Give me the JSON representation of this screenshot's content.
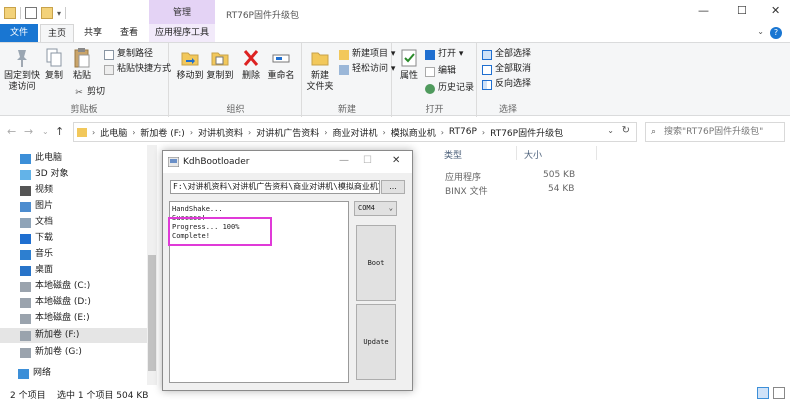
{
  "window": {
    "manage_tab": "管理",
    "title": "RT76P固件升级包",
    "min": "—",
    "max": "☐",
    "close": "✕"
  },
  "tabs": {
    "file": "文件",
    "home": "主页",
    "share": "共享",
    "view": "查看",
    "app_tools": "应用程序工具"
  },
  "ribbon": {
    "clipboard": {
      "label": "剪贴板",
      "pin": "固定到快\n速访问",
      "copy": "复制",
      "paste": "粘贴",
      "copy_path": "复制路径",
      "paste_shortcut": "粘贴快捷方式",
      "cut": "剪切"
    },
    "organize": {
      "label": "组织",
      "move_to": "移动到",
      "copy_to": "复制到",
      "delete": "删除",
      "rename": "重命名"
    },
    "new": {
      "label": "新建",
      "new_folder": "新建\n文件夹",
      "new_item": "新建项目 ▾",
      "easy_access": "轻松访问 ▾"
    },
    "open": {
      "label": "打开",
      "properties": "属性",
      "open": "打开 ▾",
      "edit": "编辑",
      "history": "历史记录"
    },
    "select": {
      "label": "选择",
      "select_all": "全部选择",
      "select_none": "全部取消",
      "invert": "反向选择"
    }
  },
  "address": {
    "crumbs": [
      "此电脑",
      "新加卷 (F:)",
      "对讲机资料",
      "对讲机广告资料",
      "商业对讲机",
      "模拟商业机",
      "RT76P",
      "RT76P固件升级包"
    ],
    "search_placeholder": "搜索\"RT76P固件升级包\""
  },
  "nav": {
    "items": [
      {
        "label": "此电脑",
        "icon": "computer-icon"
      },
      {
        "label": "3D 对象",
        "icon": "3d-objects-icon"
      },
      {
        "label": "视频",
        "icon": "video-icon"
      },
      {
        "label": "图片",
        "icon": "pictures-icon"
      },
      {
        "label": "文档",
        "icon": "documents-icon"
      },
      {
        "label": "下载",
        "icon": "download-icon"
      },
      {
        "label": "音乐",
        "icon": "music-icon"
      },
      {
        "label": "桌面",
        "icon": "desktop-icon"
      },
      {
        "label": "本地磁盘 (C:)",
        "icon": "drive-icon"
      },
      {
        "label": "本地磁盘 (D:)",
        "icon": "drive-icon"
      },
      {
        "label": "本地磁盘 (E:)",
        "icon": "drive-icon"
      },
      {
        "label": "新加卷 (F:)",
        "icon": "drive-icon"
      },
      {
        "label": "新加卷 (G:)",
        "icon": "drive-icon"
      },
      {
        "label": "网络",
        "icon": "network-icon"
      }
    ]
  },
  "files": {
    "columns": {
      "type": "类型",
      "size": "大小"
    },
    "rows": [
      {
        "type": "应用程序",
        "size": "505 KB"
      },
      {
        "type": "BINX 文件",
        "size": "54 KB"
      }
    ]
  },
  "status": {
    "count": "2 个项目",
    "selection": "选中 1 个项目  504 KB"
  },
  "dialog": {
    "title": "KdhBootloader",
    "path": "F:\\对讲机资料\\对讲机广告资料\\商业对讲机\\模拟商业机\\",
    "browse": "...",
    "log": [
      "HandShake...",
      "Success!",
      "Progress... 100%",
      "Complete!"
    ],
    "port": "COM4",
    "boot_button": "Boot",
    "update_button": "Update",
    "highlight_color": "#e03ad8"
  }
}
